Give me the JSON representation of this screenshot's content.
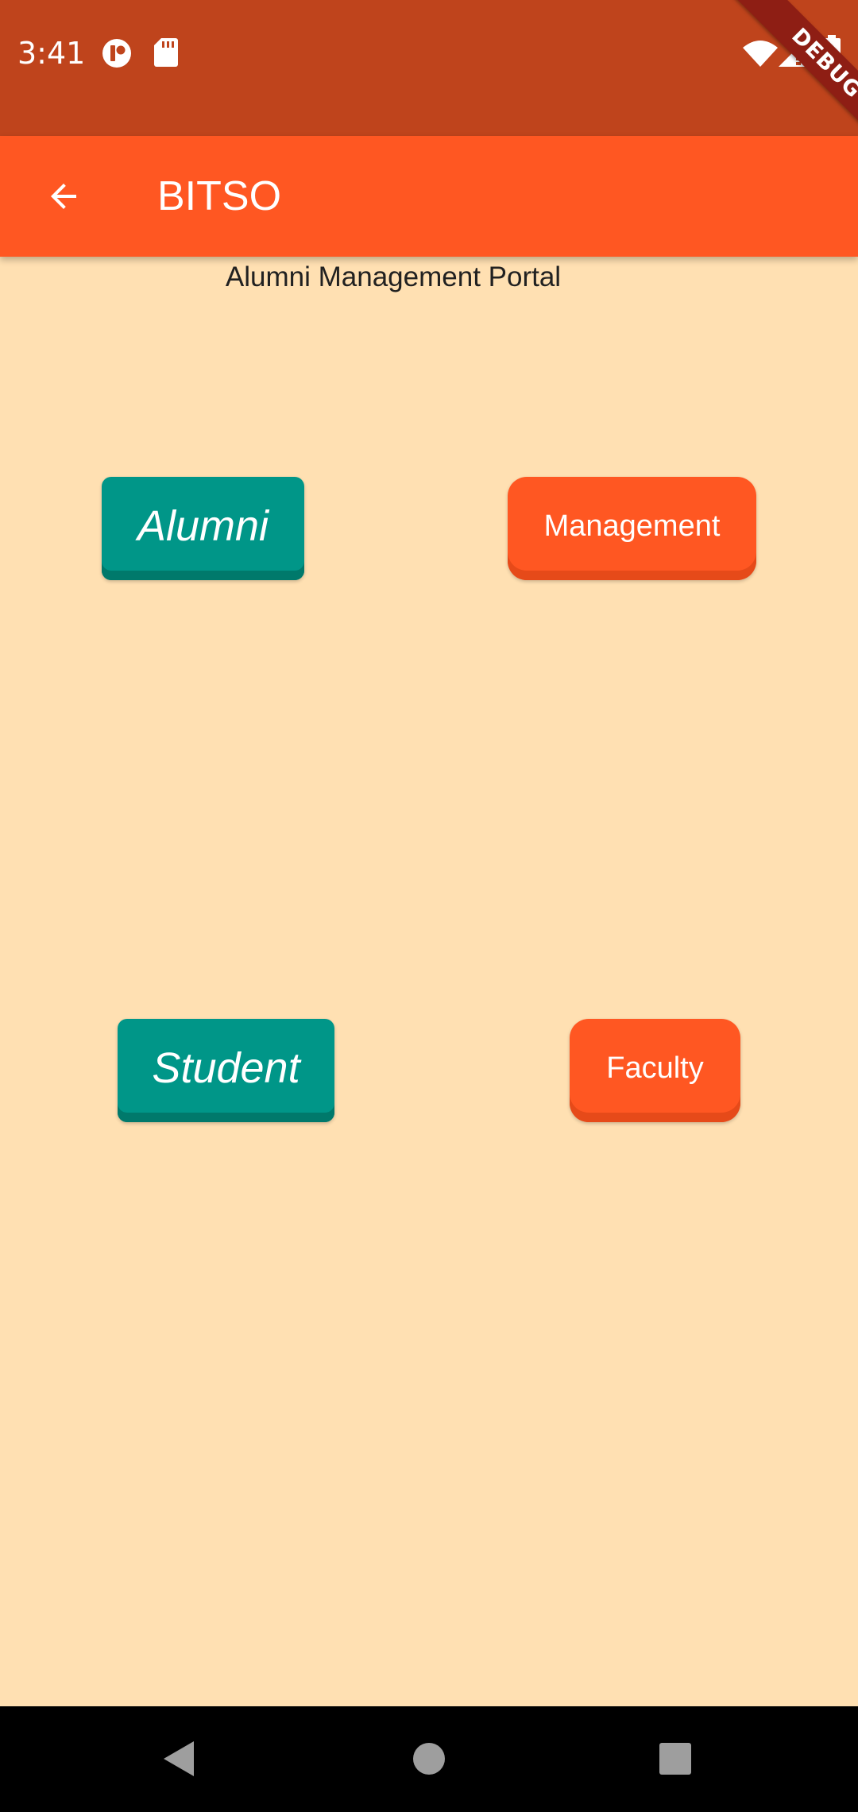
{
  "status_bar": {
    "time": "3:41",
    "icons": [
      "notification-app-icon",
      "sd-card-icon",
      "wifi-icon",
      "signal-icon",
      "battery-icon"
    ],
    "background_color": "#BF441C"
  },
  "debug_banner": {
    "label": "DEBUG"
  },
  "app_bar": {
    "title": "BITSO",
    "back_icon": "arrow-back-icon",
    "background_color": "#FF5722"
  },
  "main": {
    "subtitle": "Alumni Management Portal",
    "background_color": "#FFE0B2",
    "buttons": {
      "alumni": "Alumni",
      "management": "Management",
      "student": "Student",
      "faculty": "Faculty"
    },
    "colors": {
      "teal": "#009688",
      "orange": "#FF5722"
    }
  },
  "nav_bar": {
    "icons": [
      "nav-back-icon",
      "nav-home-icon",
      "nav-recents-icon"
    ]
  }
}
